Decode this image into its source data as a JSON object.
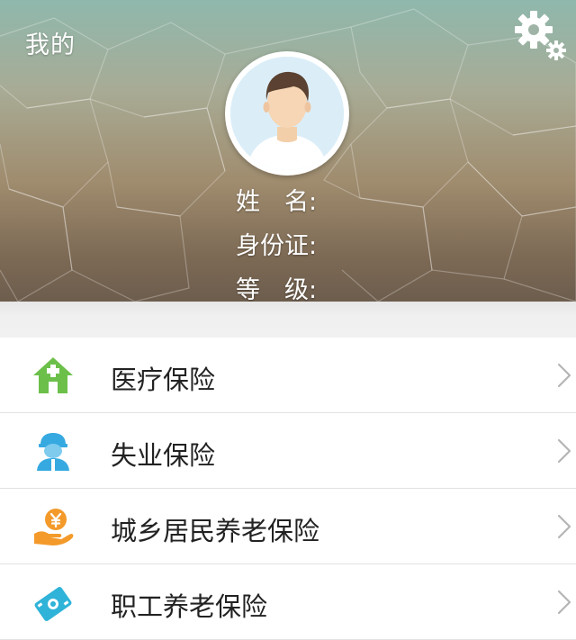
{
  "header": {
    "title": "我的",
    "settings_icon": "gear-icon",
    "avatar_icon": "user-avatar-icon",
    "fields": {
      "name_label": "姓　名:",
      "id_label": "身份证:",
      "level_label": "等　级:"
    }
  },
  "menu": {
    "items": [
      {
        "label": "医疗保险",
        "icon": "house-plus-icon",
        "color": "#6cc04a"
      },
      {
        "label": "失业保险",
        "icon": "worker-helmet-icon",
        "color": "#36a9e1"
      },
      {
        "label": "城乡居民养老保险",
        "icon": "hand-coin-icon",
        "color": "#f39a2b"
      },
      {
        "label": "职工养老保险",
        "icon": "card-icon",
        "color": "#2fb3d8"
      }
    ]
  }
}
